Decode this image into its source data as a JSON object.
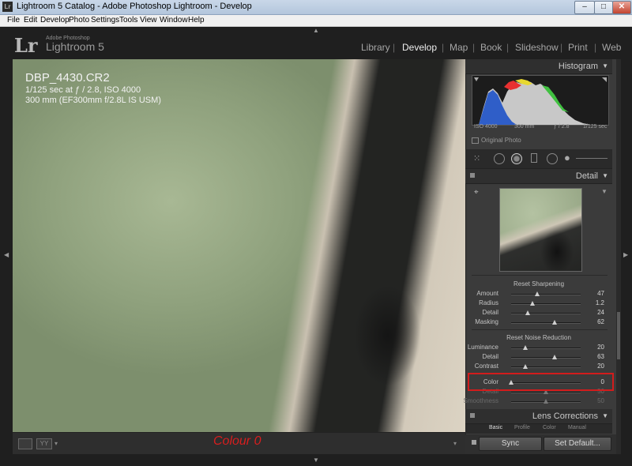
{
  "window": {
    "title": "Lightroom 5 Catalog - Adobe Photoshop Lightroom - Develop",
    "app_icon": "Lr",
    "controls": {
      "minimize": "–",
      "maximize": "□",
      "close": "✕"
    }
  },
  "menu": [
    "File",
    "Edit",
    "Develop",
    "Photo",
    "Settings",
    "Tools",
    "View",
    "Window",
    "Help"
  ],
  "identity": {
    "logo": "Lr",
    "brand_small": "Adobe Photoshop",
    "brand": "Lightroom 5"
  },
  "modules": [
    "Library",
    "Develop",
    "Map",
    "Book",
    "Slideshow",
    "Print",
    "Web"
  ],
  "active_module": "Develop",
  "photo_info": {
    "filename": "DBP_4430.CR2",
    "exposure": "1/125 sec at ƒ / 2.8, ISO 4000",
    "lens": "300 mm (EF300mm f/2.8L IS USM)"
  },
  "toolbar": {
    "annotation": "Colour 0",
    "view_btn_2": "YY",
    "caret": "▾"
  },
  "histogram": {
    "panel_label": "Histogram",
    "iso": "ISO 4000",
    "focal": "300 mm",
    "aperture": "ƒ / 2.8",
    "shutter": "1/125 sec",
    "original_photo": "Original Photo"
  },
  "detail": {
    "panel_label": "Detail",
    "sharpening_title": "Reset Sharpening",
    "sharpening": [
      {
        "label": "Amount",
        "value": "47",
        "pos": 0.37
      },
      {
        "label": "Radius",
        "value": "1.2",
        "pos": 0.31
      },
      {
        "label": "Detail",
        "value": "24",
        "pos": 0.24
      },
      {
        "label": "Masking",
        "value": "62",
        "pos": 0.62
      }
    ],
    "noise_title": "Reset Noise Reduction",
    "noise": [
      {
        "label": "Luminance",
        "value": "20",
        "pos": 0.2
      },
      {
        "label": "Detail",
        "value": "63",
        "pos": 0.63
      },
      {
        "label": "Contrast",
        "value": "20",
        "pos": 0.2
      }
    ],
    "color_noise": [
      {
        "label": "Color",
        "value": "0",
        "pos": 0.0
      },
      {
        "label": "Detail",
        "value": "50",
        "pos": 0.5
      },
      {
        "label": "Smoothness",
        "value": "50",
        "pos": 0.5
      }
    ]
  },
  "lens": {
    "panel_label": "Lens Corrections",
    "tabs": [
      "Basic",
      "Profile",
      "Color",
      "Manual"
    ],
    "active_tab": "Basic"
  },
  "sync": {
    "sync_label": "Sync",
    "default_label": "Set Default..."
  },
  "colors": {
    "accent_red": "#d21c1c",
    "panel_bg": "#3b3b3b",
    "window_bg": "#1e1e1e"
  }
}
